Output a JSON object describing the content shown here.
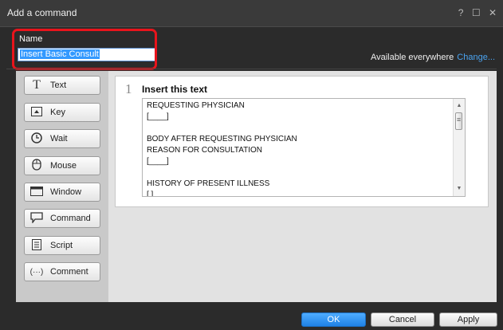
{
  "window": {
    "title": "Add a command",
    "help_label": "?"
  },
  "name_field": {
    "label": "Name",
    "value": "Insert Basic Consult"
  },
  "availability": {
    "label": "Available everywhere",
    "change_link": "Change..."
  },
  "palette": [
    {
      "label": "Text",
      "icon": "text-T-icon"
    },
    {
      "label": "Key",
      "icon": "key-icon"
    },
    {
      "label": "Wait",
      "icon": "clock-icon"
    },
    {
      "label": "Mouse",
      "icon": "mouse-icon"
    },
    {
      "label": "Window",
      "icon": "window-icon"
    },
    {
      "label": "Command",
      "icon": "speech-bubble-icon"
    },
    {
      "label": "Script",
      "icon": "script-icon"
    },
    {
      "label": "Comment",
      "icon": "comment-icon"
    }
  ],
  "step": {
    "number": "1",
    "heading": "Insert this text",
    "lines": [
      "REQUESTING PHYSICIAN",
      "[____]",
      "",
      "BODY AFTER REQUESTING PHYSICIAN",
      "REASON FOR CONSULTATION",
      "[____]",
      "",
      "HISTORY OF PRESENT ILLNESS",
      "[    ]"
    ]
  },
  "buttons": {
    "ok": "OK",
    "cancel": "Cancel",
    "apply": "Apply"
  },
  "colors": {
    "accent": "#1f82e6",
    "highlight_border": "#e8141c",
    "link": "#4aa3f0"
  }
}
